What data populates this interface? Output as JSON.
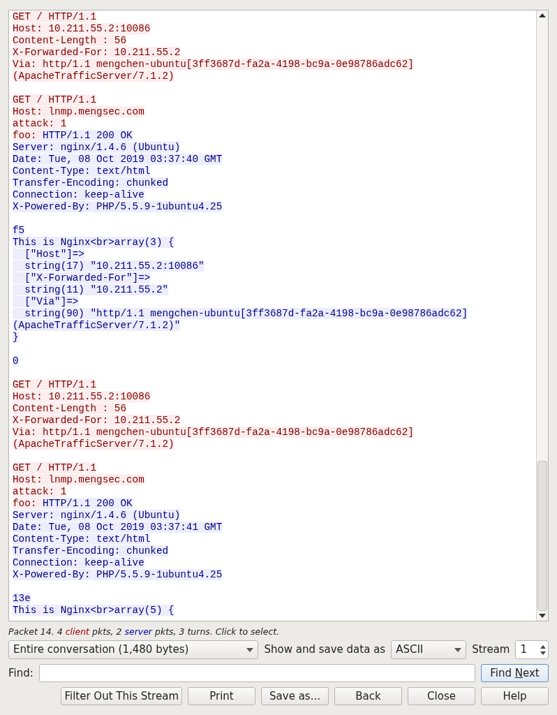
{
  "stream_text": [
    {
      "kind": "text",
      "segments": [
        {
          "from_client": true,
          "text": "GET / HTTP/1.1"
        }
      ]
    },
    {
      "kind": "text",
      "segments": [
        {
          "from_client": true,
          "text": "Host: 10.211.55.2:10086"
        }
      ]
    },
    {
      "kind": "text",
      "segments": [
        {
          "from_client": true,
          "text": "Content-Length : 56"
        }
      ]
    },
    {
      "kind": "text",
      "segments": [
        {
          "from_client": true,
          "text": "X-Forwarded-For: 10.211.55.2"
        }
      ]
    },
    {
      "kind": "text",
      "segments": [
        {
          "from_client": true,
          "text": "Via: http/1.1 mengchen-ubuntu[3ff3687d-fa2a-4198-bc9a-0e98786adc62]"
        }
      ]
    },
    {
      "kind": "text",
      "segments": [
        {
          "from_client": true,
          "text": "(ApacheTrafficServer/7.1.2)"
        }
      ]
    },
    {
      "kind": "blank"
    },
    {
      "kind": "text",
      "segments": [
        {
          "from_client": true,
          "text": "GET / HTTP/1.1"
        }
      ]
    },
    {
      "kind": "text",
      "segments": [
        {
          "from_client": true,
          "text": "Host: lnmp.mengsec.com"
        }
      ]
    },
    {
      "kind": "text",
      "segments": [
        {
          "from_client": true,
          "text": "attack: 1"
        }
      ]
    },
    {
      "kind": "text",
      "segments": [
        {
          "from_client": true,
          "text": "foo: "
        },
        {
          "from_client": false,
          "text": "HTTP/1.1 200 OK"
        }
      ]
    },
    {
      "kind": "text",
      "segments": [
        {
          "from_client": false,
          "text": "Server: nginx/1.4.6 (Ubuntu)"
        }
      ]
    },
    {
      "kind": "text",
      "segments": [
        {
          "from_client": false,
          "text": "Date: Tue, 08 Oct 2019 03:37:40 GMT"
        }
      ]
    },
    {
      "kind": "text",
      "segments": [
        {
          "from_client": false,
          "text": "Content-Type: text/html"
        }
      ]
    },
    {
      "kind": "text",
      "segments": [
        {
          "from_client": false,
          "text": "Transfer-Encoding: chunked"
        }
      ]
    },
    {
      "kind": "text",
      "segments": [
        {
          "from_client": false,
          "text": "Connection: keep-alive"
        }
      ]
    },
    {
      "kind": "text",
      "segments": [
        {
          "from_client": false,
          "text": "X-Powered-By: PHP/5.5.9-1ubuntu4.25"
        }
      ]
    },
    {
      "kind": "blank"
    },
    {
      "kind": "text",
      "segments": [
        {
          "from_client": false,
          "text": "f5"
        }
      ]
    },
    {
      "kind": "text",
      "segments": [
        {
          "from_client": false,
          "text": "This is Nginx<br>array(3) {"
        }
      ]
    },
    {
      "kind": "text",
      "segments": [
        {
          "from_client": false,
          "text": "  [\"Host\"]=>"
        }
      ]
    },
    {
      "kind": "text",
      "segments": [
        {
          "from_client": false,
          "text": "  string(17) \"10.211.55.2:10086\""
        }
      ]
    },
    {
      "kind": "text",
      "segments": [
        {
          "from_client": false,
          "text": "  [\"X-Forwarded-For\"]=>"
        }
      ]
    },
    {
      "kind": "text",
      "segments": [
        {
          "from_client": false,
          "text": "  string(11) \"10.211.55.2\""
        }
      ]
    },
    {
      "kind": "text",
      "segments": [
        {
          "from_client": false,
          "text": "  [\"Via\"]=>"
        }
      ]
    },
    {
      "kind": "text",
      "segments": [
        {
          "from_client": false,
          "text": "  string(90) \"http/1.1 mengchen-ubuntu[3ff3687d-fa2a-4198-bc9a-0e98786adc62]"
        }
      ]
    },
    {
      "kind": "text",
      "segments": [
        {
          "from_client": false,
          "text": "(ApacheTrafficServer/7.1.2)\""
        }
      ]
    },
    {
      "kind": "text",
      "segments": [
        {
          "from_client": false,
          "text": "}"
        }
      ]
    },
    {
      "kind": "blank"
    },
    {
      "kind": "text",
      "segments": [
        {
          "from_client": false,
          "text": "0"
        }
      ]
    },
    {
      "kind": "blank"
    },
    {
      "kind": "text",
      "segments": [
        {
          "from_client": true,
          "text": "GET / HTTP/1.1"
        }
      ]
    },
    {
      "kind": "text",
      "segments": [
        {
          "from_client": true,
          "text": "Host: 10.211.55.2:10086"
        }
      ]
    },
    {
      "kind": "text",
      "segments": [
        {
          "from_client": true,
          "text": "Content-Length : 56"
        }
      ]
    },
    {
      "kind": "text",
      "segments": [
        {
          "from_client": true,
          "text": "X-Forwarded-For: 10.211.55.2"
        }
      ]
    },
    {
      "kind": "text",
      "segments": [
        {
          "from_client": true,
          "text": "Via: http/1.1 mengchen-ubuntu[3ff3687d-fa2a-4198-bc9a-0e98786adc62]"
        }
      ]
    },
    {
      "kind": "text",
      "segments": [
        {
          "from_client": true,
          "text": "(ApacheTrafficServer/7.1.2)"
        }
      ]
    },
    {
      "kind": "blank"
    },
    {
      "kind": "text",
      "segments": [
        {
          "from_client": true,
          "text": "GET / HTTP/1.1"
        }
      ]
    },
    {
      "kind": "text",
      "segments": [
        {
          "from_client": true,
          "text": "Host: lnmp.mengsec.com"
        }
      ]
    },
    {
      "kind": "text",
      "segments": [
        {
          "from_client": true,
          "text": "attack: 1"
        }
      ]
    },
    {
      "kind": "text",
      "segments": [
        {
          "from_client": true,
          "text": "foo: "
        },
        {
          "from_client": false,
          "text": "HTTP/1.1 200 OK"
        }
      ]
    },
    {
      "kind": "text",
      "segments": [
        {
          "from_client": false,
          "text": "Server: nginx/1.4.6 (Ubuntu)"
        }
      ]
    },
    {
      "kind": "text",
      "segments": [
        {
          "from_client": false,
          "text": "Date: Tue, 08 Oct 2019 03:37:41 GMT"
        }
      ]
    },
    {
      "kind": "text",
      "segments": [
        {
          "from_client": false,
          "text": "Content-Type: text/html"
        }
      ]
    },
    {
      "kind": "text",
      "segments": [
        {
          "from_client": false,
          "text": "Transfer-Encoding: chunked"
        }
      ]
    },
    {
      "kind": "text",
      "segments": [
        {
          "from_client": false,
          "text": "Connection: keep-alive"
        }
      ]
    },
    {
      "kind": "text",
      "segments": [
        {
          "from_client": false,
          "text": "X-Powered-By: PHP/5.5.9-1ubuntu4.25"
        }
      ]
    },
    {
      "kind": "blank"
    },
    {
      "kind": "text",
      "segments": [
        {
          "from_client": false,
          "text": "13e"
        }
      ]
    },
    {
      "kind": "text",
      "segments": [
        {
          "from_client": false,
          "text": "This is Nginx<br>array(5) {"
        }
      ]
    }
  ],
  "status_line": [
    {
      "kind": "none",
      "text": "Packet 14. 4 "
    },
    {
      "kind": "client",
      "text": "client"
    },
    {
      "kind": "none",
      "text": " pkts, 2 "
    },
    {
      "kind": "server",
      "text": "server"
    },
    {
      "kind": "none",
      "text": " pkts, 3 turns. Click to select."
    }
  ],
  "conversation_select": {
    "value": "Entire conversation (1,480 bytes)"
  },
  "format_label": "Show and save data as",
  "format_select": {
    "value": "ASCII"
  },
  "stream_label": "Stream",
  "stream_spin": {
    "value": "1"
  },
  "find_label": "Find:",
  "find_next_button": {
    "before": "Find ",
    "key": "N",
    "after": "ext"
  },
  "buttons": [
    "Filter Out This Stream",
    "Print",
    "Save as...",
    "Back",
    "Close",
    "Help"
  ]
}
